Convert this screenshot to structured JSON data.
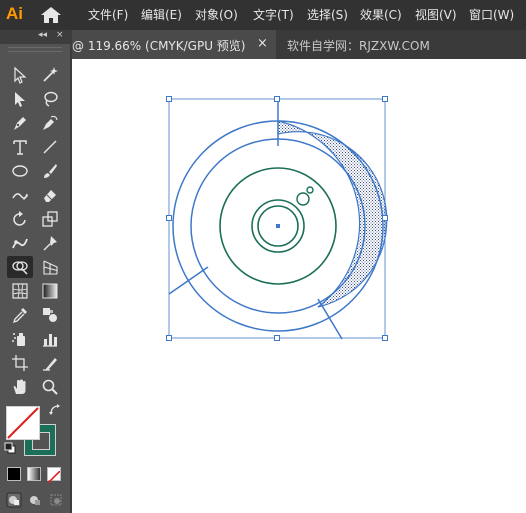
{
  "app": {
    "logo_text": "Ai"
  },
  "menu": [
    {
      "label": "文件(F)"
    },
    {
      "label": "编辑(E)"
    },
    {
      "label": "对象(O)"
    },
    {
      "label": "文字(T)"
    },
    {
      "label": "选择(S)"
    },
    {
      "label": "效果(C)"
    },
    {
      "label": "视图(V)"
    },
    {
      "label": "窗口(W)"
    }
  ],
  "tabs": {
    "active": {
      "title": "@ 119.66% (CMYK/GPU 预览)",
      "close": "×"
    },
    "inactive": {
      "title": "软件自学网：RJZXW.COM"
    }
  },
  "toolbar": {
    "collapse": "◂◂",
    "close": "×",
    "tools": [
      "selection-tool-icon",
      "magic-wand-icon",
      "direct-selection-icon",
      "lasso-icon",
      "pen-tool-icon",
      "curvature-tool-icon",
      "type-tool-icon",
      "line-segment-icon",
      "ellipse-tool-icon",
      "paintbrush-icon",
      "shaper-tool-icon",
      "eraser-icon",
      "rotate-tool-icon",
      "scale-tool-icon",
      "puppet-warp-icon",
      "pin-icon",
      "shape-builder-icon",
      "perspective-grid-icon",
      "mesh-tool-icon",
      "gradient-tool-icon",
      "eyedropper-icon",
      "blend-tool-icon",
      "symbol-sprayer-icon",
      "column-graph-icon",
      "artboard-tool-icon",
      "slice-tool-icon",
      "hand-tool-icon",
      "zoom-tool-icon"
    ],
    "selected_tool": "shape-builder-icon",
    "fill_color": "none",
    "stroke_color": "#1b6e58"
  },
  "artwork": {
    "accent_color": "#3e78c9",
    "shape_color": "#1b6e58"
  }
}
